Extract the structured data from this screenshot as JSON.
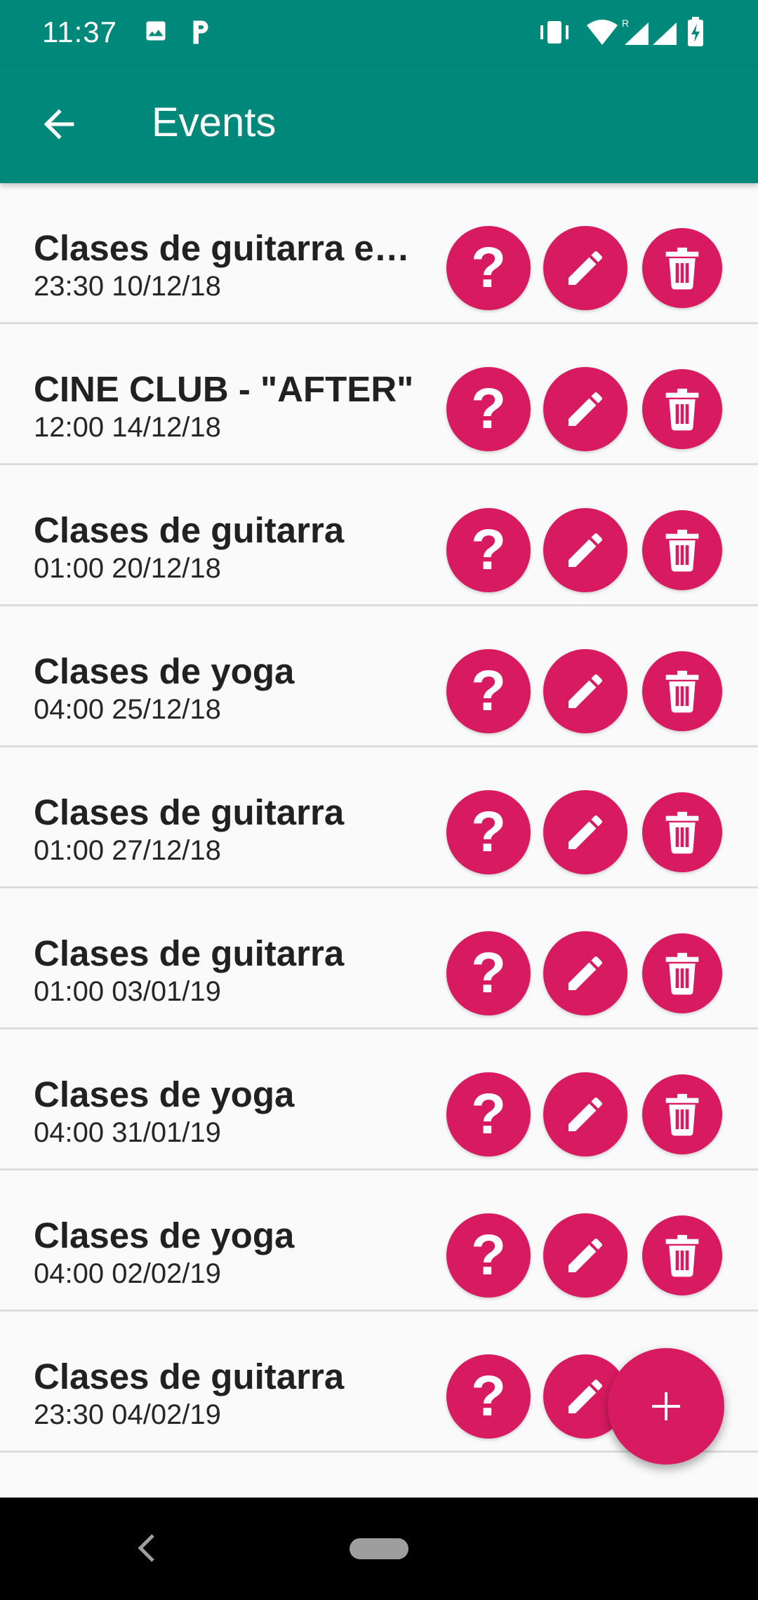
{
  "status_bar": {
    "time": "11:37",
    "left_icons": [
      "image-icon",
      "parking-icon"
    ],
    "right_icons": [
      "vibrate-icon",
      "wifi-icon",
      "signal-roaming-icon",
      "signal-icon",
      "battery-charging-icon"
    ]
  },
  "app_bar": {
    "title": "Events",
    "back_icon": "arrow-back-icon"
  },
  "colors": {
    "primary": "#00897b",
    "accent": "#d81b60"
  },
  "events": [
    {
      "title": "Clases de guitarra es…",
      "datetime": "23:30 10/12/18"
    },
    {
      "title": "CINE CLUB - \"AFTER\"",
      "datetime": "12:00 14/12/18"
    },
    {
      "title": "Clases de guitarra",
      "datetime": "01:00 20/12/18"
    },
    {
      "title": "Clases de yoga",
      "datetime": "04:00 25/12/18"
    },
    {
      "title": "Clases de guitarra",
      "datetime": "01:00 27/12/18"
    },
    {
      "title": "Clases de guitarra",
      "datetime": "01:00 03/01/19"
    },
    {
      "title": "Clases de yoga",
      "datetime": "04:00 31/01/19"
    },
    {
      "title": "Clases de yoga",
      "datetime": "04:00 02/02/19"
    },
    {
      "title": "Clases de guitarra",
      "datetime": "23:30 04/02/19"
    }
  ],
  "row_actions": {
    "help_glyph": "?",
    "help_icon": "help-icon",
    "edit_icon": "pencil-icon",
    "delete_icon": "trash-icon"
  },
  "fab": {
    "icon": "plus-icon"
  },
  "nav_bar": {
    "back_icon": "nav-back-icon",
    "home_icon": "nav-home-pill"
  }
}
